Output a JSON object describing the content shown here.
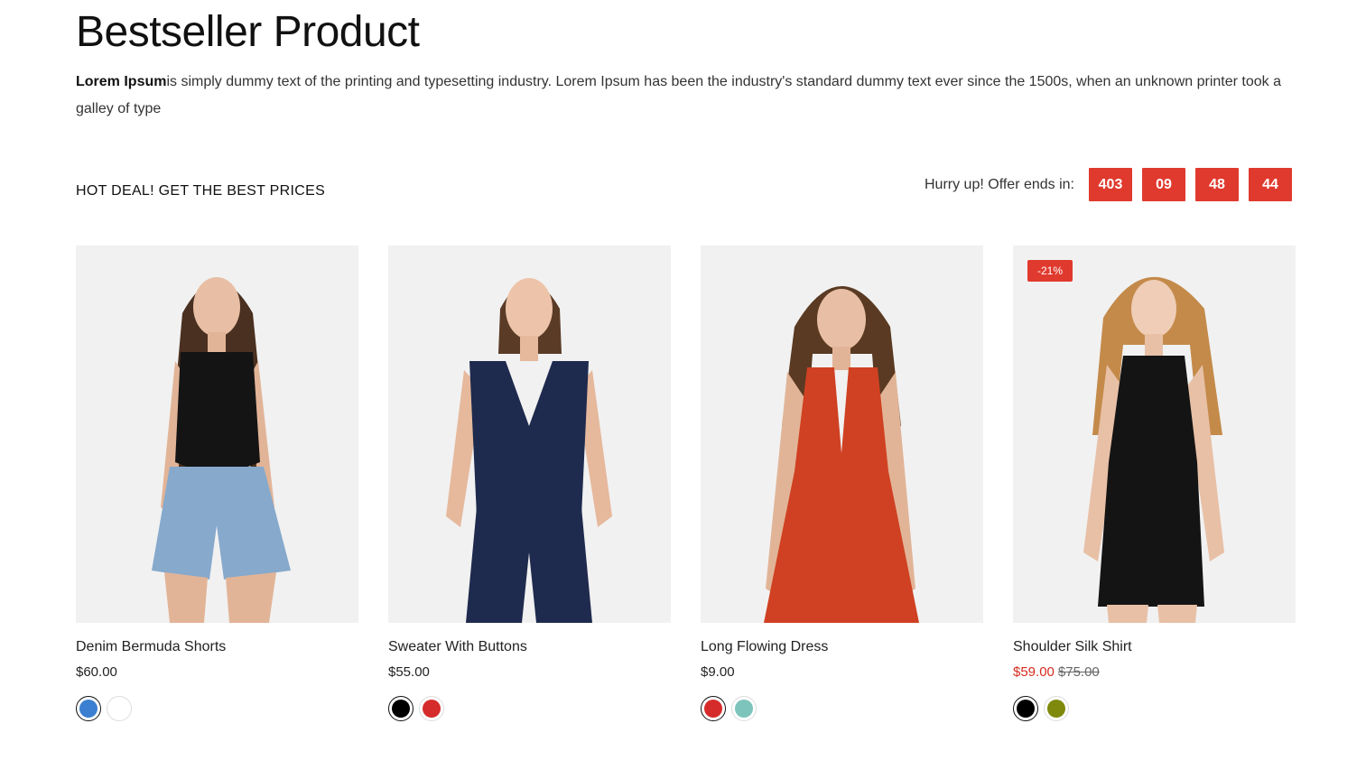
{
  "section": {
    "title": "Bestseller Product",
    "intro_bold": "Lorem Ipsum",
    "intro_rest": "is simply dummy text of the printing and typesetting industry. Lorem Ipsum has been the industry's standard dummy text ever since the 1500s, when an unknown printer took a galley of type"
  },
  "deal": {
    "heading": "HOT DEAL! GET THE BEST PRICES",
    "countdown_label": "Hurry up! Offer ends in:",
    "days": "403",
    "hours": "09",
    "minutes": "48",
    "seconds": "44",
    "accent_color": "#e03a2e"
  },
  "products": [
    {
      "name": "Denim Bermuda Shorts",
      "price": "$60.00",
      "swatches": [
        "#3a7fd0",
        "#ffffff"
      ],
      "garment": "#141414",
      "bottom": "#86a9cc",
      "hair": "#4a3020"
    },
    {
      "name": "Sweater With Buttons",
      "price": "$55.00",
      "swatches": [
        "#000000",
        "#d62b2b"
      ],
      "garment": "#1e2a4e",
      "bottom": "#1e2a4e",
      "hair": "#5a3b26"
    },
    {
      "name": "Long Flowing Dress",
      "price": "$9.00",
      "swatches": [
        "#d62b2b",
        "#7dc4bc"
      ],
      "garment": "#cf4122",
      "bottom": "#cf4122",
      "hair": "#5a3a22"
    },
    {
      "name": "Shoulder Silk Shirt",
      "badge": "-21%",
      "sale_price": "$59.00",
      "old_price": "$75.00",
      "swatches": [
        "#000000",
        "#7f8a0c"
      ],
      "garment": "#141414",
      "bottom": "#141414",
      "hair": "#c48a4a"
    }
  ]
}
